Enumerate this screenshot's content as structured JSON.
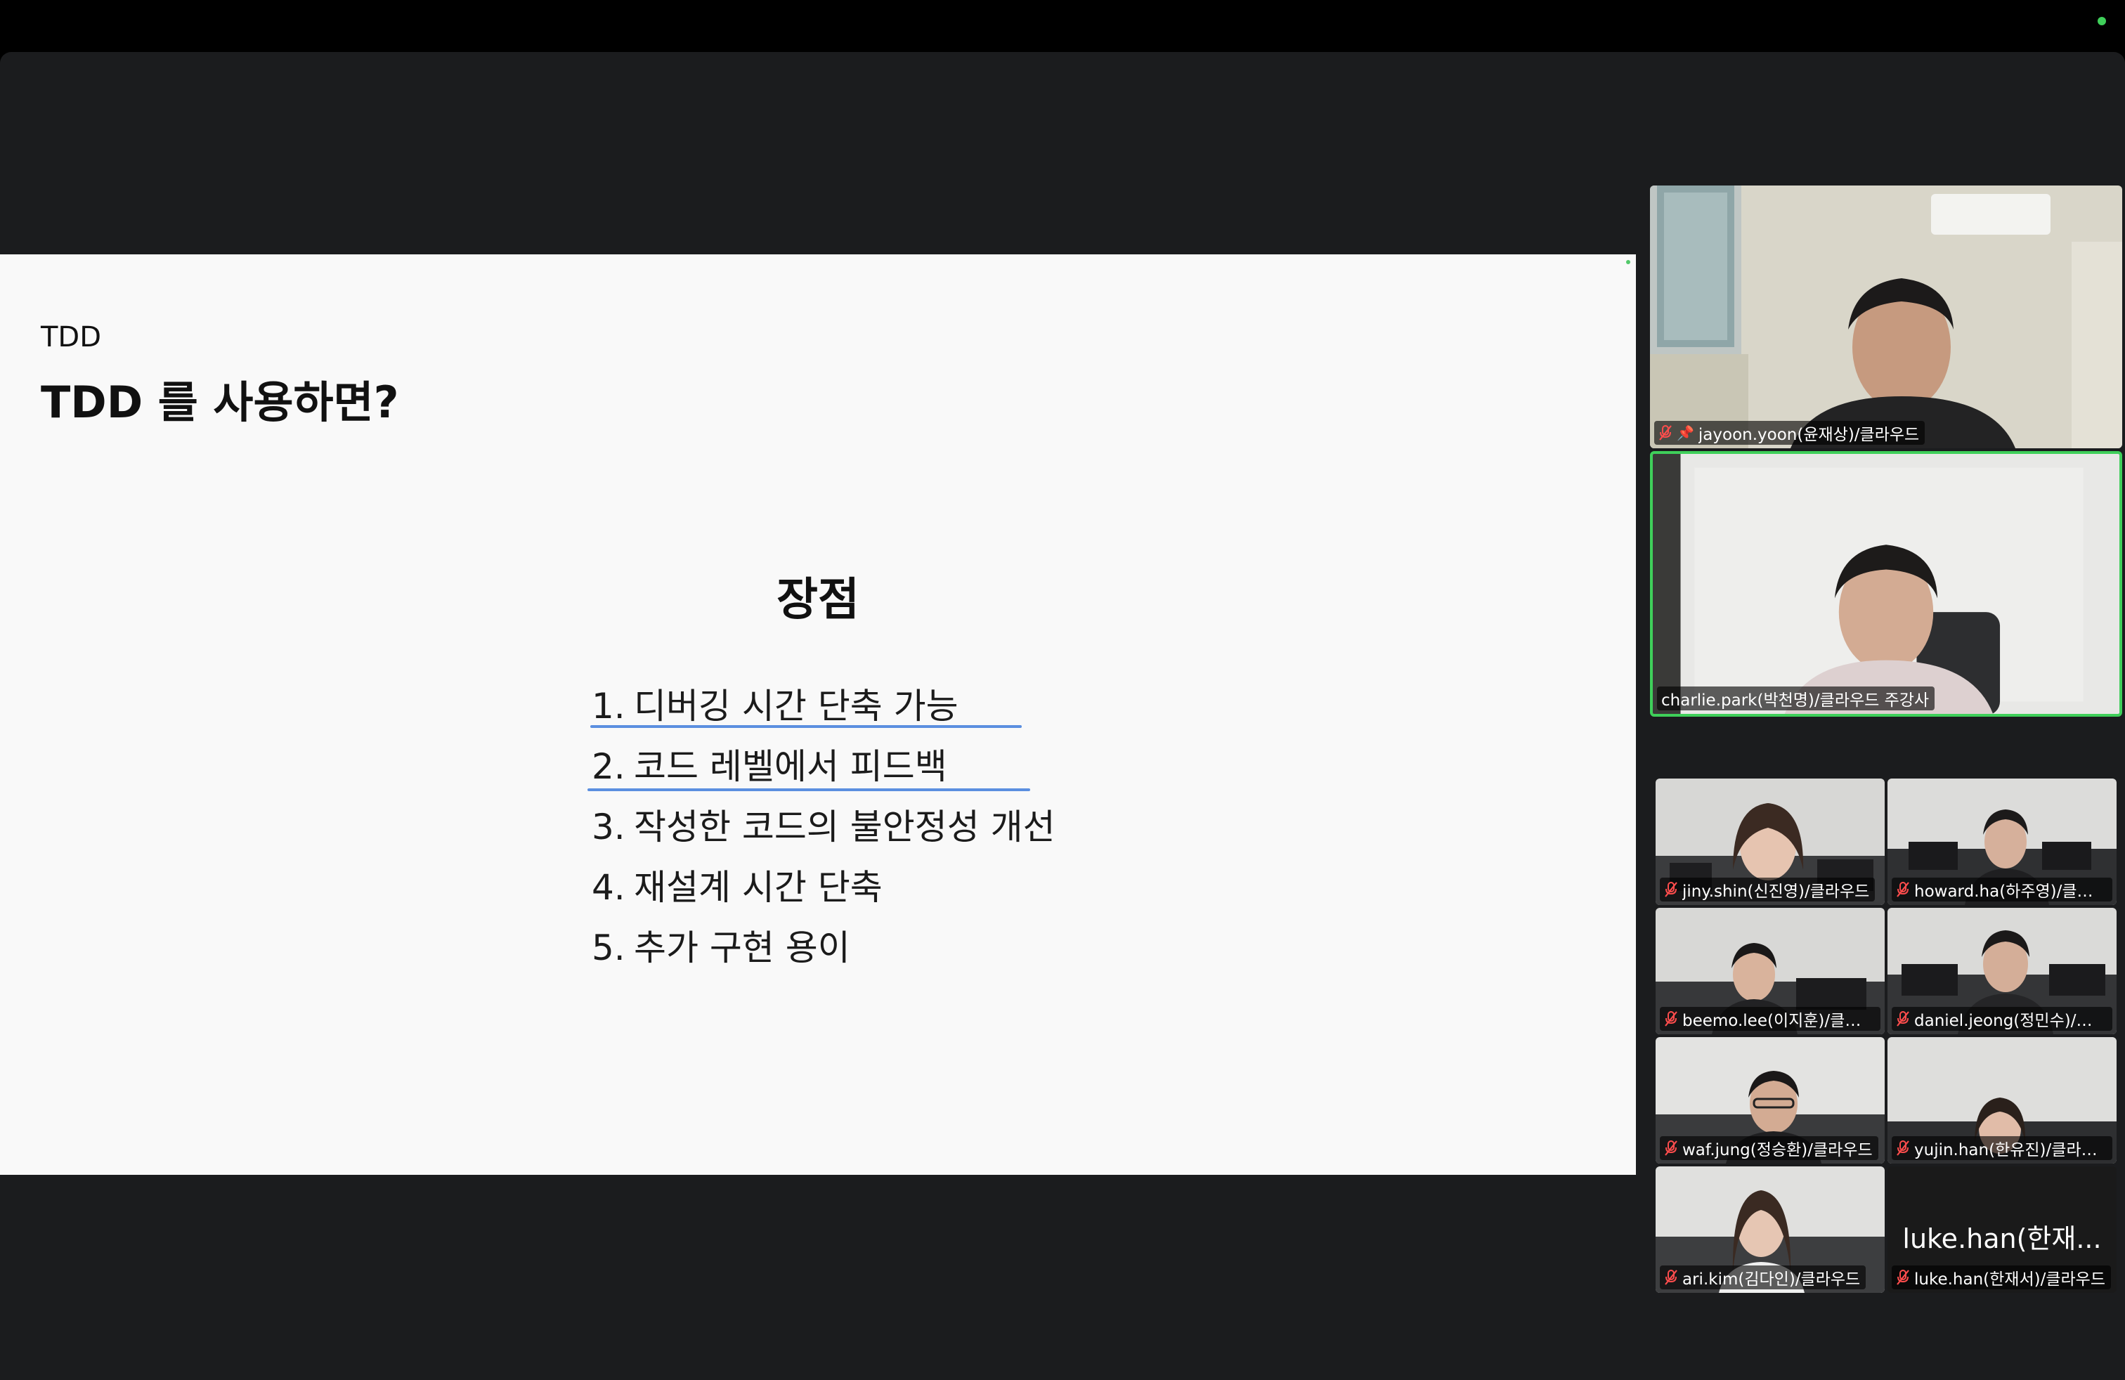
{
  "app": {
    "status_color": "#3fcf5a"
  },
  "slide": {
    "section": "TDD",
    "title": "TDD 를 사용하면?",
    "heading": "장점",
    "items": [
      {
        "num": "1.",
        "text": "디버깅 시간 단축 가능"
      },
      {
        "num": "2.",
        "text": "코드 레벨에서 피드백"
      },
      {
        "num": "3.",
        "text": "작성한 코드의 불안정성 개선"
      },
      {
        "num": "4.",
        "text": "재설계 시간 단축"
      },
      {
        "num": "5.",
        "text": "추가 구현 용이"
      }
    ],
    "underline_color": "#5b8fe0"
  },
  "participants": {
    "pinned": {
      "name": "jayoon.yoon(윤재상)/클라우드",
      "muted": true,
      "pinned": true
    },
    "speaker": {
      "name": "charlie.park(박천명)/클라우드 주강사",
      "muted": false,
      "speaking": true
    },
    "grid": [
      {
        "name": "jiny.shin(신진영)/클라우드",
        "muted": true
      },
      {
        "name": "howard.ha(하주영)/클라우드",
        "muted": true
      },
      {
        "name": "beemo.lee(이지훈)/클라우드",
        "muted": true
      },
      {
        "name": "daniel.jeong(정민수)/클라우드",
        "muted": true
      },
      {
        "name": "waf.jung(정승환)/클라우드",
        "muted": true
      },
      {
        "name": "yujin.han(한유진)/클라우드",
        "muted": true
      },
      {
        "name": "ari.kim(김다인)/클라우드",
        "muted": true
      },
      {
        "name": "luke.han(한재서)/클라우드",
        "muted": true,
        "video_off_name": "luke.han(한재..."
      }
    ]
  }
}
